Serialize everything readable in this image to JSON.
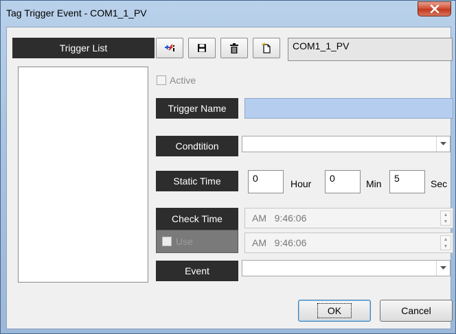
{
  "window": {
    "title": "Tag Trigger Event - COM1_1_PV"
  },
  "trigger_list": {
    "header": "Trigger List",
    "items": []
  },
  "toolbar": {
    "buttons": [
      {
        "icon": "add-trigger-icon"
      },
      {
        "icon": "save-icon"
      },
      {
        "icon": "delete-icon"
      },
      {
        "icon": "new-document-icon"
      }
    ],
    "tag_name": "COM1_1_PV"
  },
  "form": {
    "active_label": "Active",
    "active_checked": false,
    "trigger_name_label": "Trigger Name",
    "trigger_name_value": "",
    "condition_label": "Condtition",
    "condition_value": "",
    "static_time_label": "Static Time",
    "hour_value": "0",
    "hour_unit": "Hour",
    "min_value": "0",
    "min_unit": "Min",
    "sec_value": "5",
    "sec_unit": "Sec",
    "check_time_label": "Check Time",
    "check_time_start": "AM   9:46:06",
    "use_label": "Use",
    "use_checked": false,
    "check_time_end": "AM   9:46:06",
    "event_label": "Event",
    "event_value": ""
  },
  "buttons": {
    "ok": "OK",
    "cancel": "Cancel"
  },
  "colors": {
    "label_bg": "#2d2d2d",
    "name_input_bg": "#b5cef0",
    "close_button": "#c23a1f"
  }
}
